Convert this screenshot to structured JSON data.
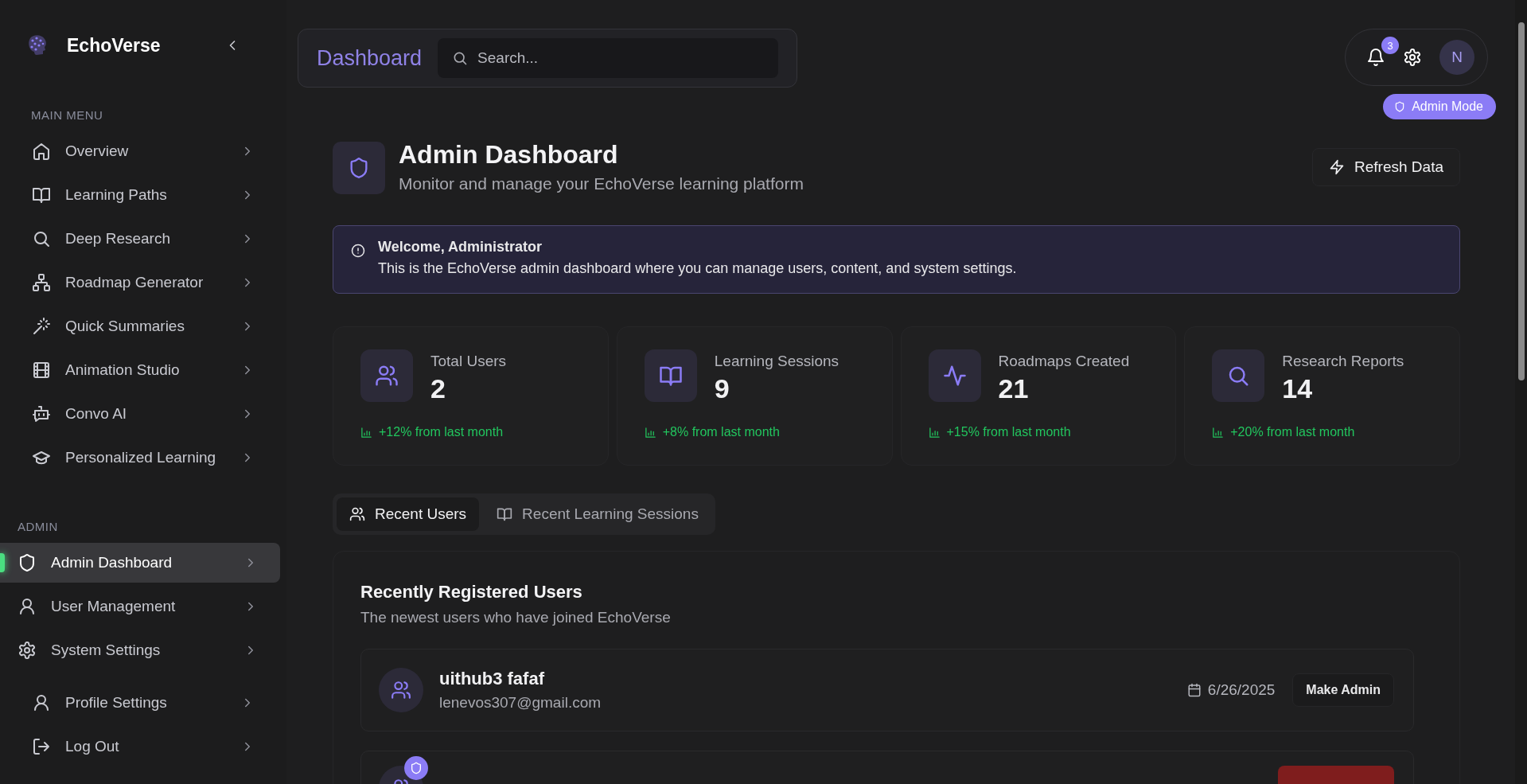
{
  "sidebar": {
    "brand": "EchoVerse",
    "sections": [
      {
        "title": "MAIN MENU",
        "items": [
          {
            "label": "Overview",
            "selected": false
          },
          {
            "label": "Learning Paths",
            "selected": false
          },
          {
            "label": "Deep Research",
            "selected": false
          },
          {
            "label": "Roadmap Generator",
            "selected": false
          },
          {
            "label": "Quick Summaries",
            "selected": false
          },
          {
            "label": "Animation Studio",
            "selected": false
          },
          {
            "label": "Convo AI",
            "selected": false
          },
          {
            "label": "Personalized Learning",
            "selected": false
          }
        ]
      },
      {
        "title": "ADMIN",
        "items": [
          {
            "label": "Admin Dashboard",
            "selected": true
          },
          {
            "label": "User Management",
            "selected": false
          },
          {
            "label": "System Settings",
            "selected": false
          }
        ]
      }
    ],
    "footer_items": [
      {
        "label": "Profile Settings"
      },
      {
        "label": "Log Out"
      }
    ]
  },
  "header": {
    "title": "Dashboard",
    "search": {
      "placeholder": "Search..."
    },
    "notification_count": "3",
    "avatar": "N",
    "mode_badge": "Admin Mode"
  },
  "page": {
    "title": "Admin Dashboard",
    "subtitle": "Monitor and manage your EchoVerse learning platform",
    "refresh_button": "Refresh Data"
  },
  "alert": {
    "title": "Welcome, Administrator",
    "message": "This is the EchoVerse admin dashboard where you can manage users, content, and system settings."
  },
  "stats": [
    {
      "label": "Total Users",
      "value": "2",
      "change": "+12% from last month"
    },
    {
      "label": "Learning Sessions",
      "value": "9",
      "change": "+8% from last month"
    },
    {
      "label": "Roadmaps Created",
      "value": "21",
      "change": "+15% from last month"
    },
    {
      "label": "Research Reports",
      "value": "14",
      "change": "+20% from last month"
    }
  ],
  "tabs": [
    {
      "label": "Recent Users",
      "selected": true
    },
    {
      "label": "Recent Learning Sessions",
      "selected": false
    }
  ],
  "users_panel": {
    "title": "Recently Registered Users",
    "description": "The newest users who have joined EchoVerse",
    "users": [
      {
        "name": "uithub3 fafaf",
        "email": "lenevos307@gmail.com",
        "date": "6/26/2025",
        "action": "Make Admin",
        "admin": false
      },
      {
        "admin": true
      }
    ]
  }
}
